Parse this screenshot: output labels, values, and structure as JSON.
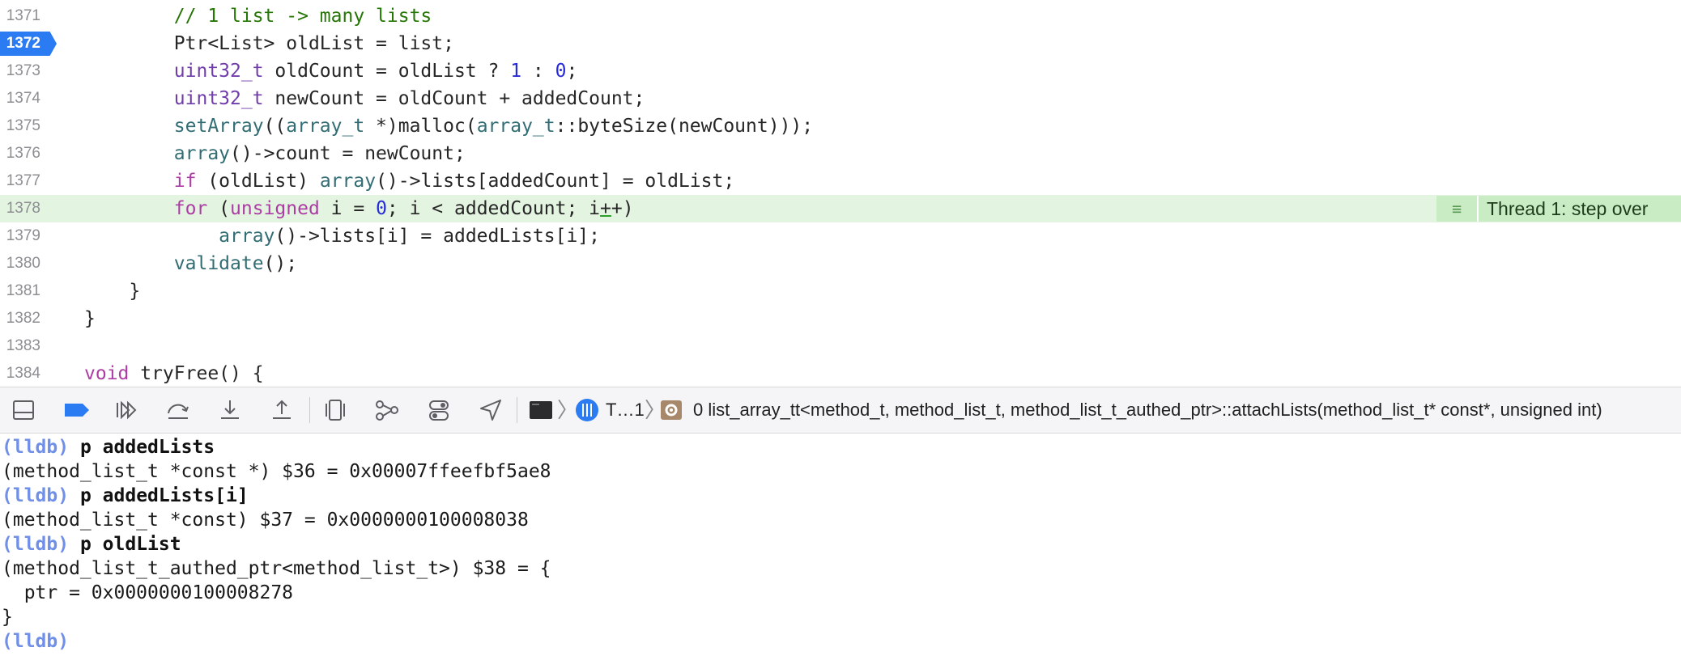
{
  "editor": {
    "lines": [
      {
        "n": "1371",
        "segs": [
          [
            "        ",
            ""
          ],
          [
            "// 1 list -> many lists",
            "cm"
          ]
        ]
      },
      {
        "n": "1372",
        "pc": true,
        "segs": [
          [
            "        ",
            ""
          ],
          [
            "Ptr<List> oldList = list;",
            ""
          ]
        ]
      },
      {
        "n": "1373",
        "segs": [
          [
            "        ",
            ""
          ],
          [
            "uint32_t",
            "ty"
          ],
          [
            " oldCount = oldList ? ",
            ""
          ],
          [
            "1",
            "num"
          ],
          [
            " : ",
            ""
          ],
          [
            "0",
            "num"
          ],
          [
            ";",
            ""
          ]
        ]
      },
      {
        "n": "1374",
        "segs": [
          [
            "        ",
            ""
          ],
          [
            "uint32_t",
            "ty"
          ],
          [
            " newCount = oldCount + addedCount;",
            ""
          ]
        ]
      },
      {
        "n": "1375",
        "segs": [
          [
            "        ",
            ""
          ],
          [
            "setArray",
            "fn"
          ],
          [
            "((",
            ""
          ],
          [
            "array_t",
            "fn"
          ],
          [
            " *)malloc(",
            ""
          ],
          [
            "array_t",
            "fn"
          ],
          [
            "::byteSize(newCount)));",
            ""
          ]
        ]
      },
      {
        "n": "1376",
        "segs": [
          [
            "        ",
            ""
          ],
          [
            "array",
            "fn"
          ],
          [
            "()->count = newCount;",
            ""
          ]
        ]
      },
      {
        "n": "1377",
        "segs": [
          [
            "        ",
            ""
          ],
          [
            "if",
            "kw"
          ],
          [
            " (oldList) ",
            ""
          ],
          [
            "array",
            "fn"
          ],
          [
            "()->lists[addedCount] = oldList;",
            ""
          ]
        ]
      },
      {
        "n": "1378",
        "current": true,
        "segs": [
          [
            "        ",
            ""
          ],
          [
            "for",
            "kw"
          ],
          [
            " (",
            ""
          ],
          [
            "unsigned",
            "kw"
          ],
          [
            " i = ",
            ""
          ],
          [
            "0",
            "num"
          ],
          [
            "; i < addedCount; i",
            ""
          ],
          [
            "+",
            "cursor"
          ],
          [
            "+)",
            ""
          ]
        ]
      },
      {
        "n": "1379",
        "segs": [
          [
            "            ",
            ""
          ],
          [
            "array",
            "fn"
          ],
          [
            "()->lists[i] = addedLists[i];",
            ""
          ]
        ]
      },
      {
        "n": "1380",
        "segs": [
          [
            "        ",
            ""
          ],
          [
            "validate",
            "fn"
          ],
          [
            "();",
            ""
          ]
        ]
      },
      {
        "n": "1381",
        "segs": [
          [
            "    }",
            ""
          ]
        ]
      },
      {
        "n": "1382",
        "segs": [
          [
            "}",
            ""
          ]
        ]
      },
      {
        "n": "1383",
        "segs": []
      },
      {
        "n": "1384",
        "segs": [
          [
            "void",
            "kw"
          ],
          [
            " tryFree() {",
            ""
          ]
        ]
      }
    ],
    "thread_badge": {
      "icon": "list-lines-icon",
      "label": "Thread 1: step over"
    }
  },
  "debug_bar": {
    "buttons": [
      {
        "name": "hide-debug-area-button",
        "icon": "panel-bottom-icon"
      },
      {
        "name": "breakpoints-toggle-button",
        "icon": "breakpoint-icon"
      },
      {
        "name": "continue-button",
        "icon": "continue-icon"
      },
      {
        "name": "step-over-button",
        "icon": "step-over-icon"
      },
      {
        "name": "step-into-button",
        "icon": "step-into-icon"
      },
      {
        "name": "step-out-button",
        "icon": "step-out-icon"
      },
      {
        "name": "debug-view-hierarchy-button",
        "icon": "view-hierarchy-icon"
      },
      {
        "name": "debug-memory-graph-button",
        "icon": "memory-graph-icon"
      },
      {
        "name": "environment-overrides-button",
        "icon": "toggles-icon"
      },
      {
        "name": "simulate-location-button",
        "icon": "location-arrow-icon"
      }
    ],
    "crumbs": {
      "process_icon": "terminal-icon",
      "thread_icon": "thread-icon",
      "thread": "T…1",
      "frame_icon": "gear-icon",
      "frame": "0 list_array_tt<method_t, method_list_t, method_list_t_authed_ptr>::attachLists(method_list_t* const*, unsigned int)"
    }
  },
  "console": {
    "prompt": "(lldb)",
    "lines": [
      {
        "prompt": true,
        "cmd": "p addedLists"
      },
      {
        "text": "(method_list_t *const *) $36 = 0x00007ffeefbf5ae8"
      },
      {
        "prompt": true,
        "cmd": "p addedLists[i]"
      },
      {
        "text": "(method_list_t *const) $37 = 0x0000000100008038"
      },
      {
        "prompt": true,
        "cmd": "p oldList"
      },
      {
        "text": "(method_list_t_authed_ptr<method_list_t>) $38 = {"
      },
      {
        "text": "  ptr = 0x0000000100008278"
      },
      {
        "text": "}"
      },
      {
        "prompt": true,
        "cmd": ""
      }
    ]
  },
  "colors": {
    "keyword": "#ad3da4",
    "type": "#703daa",
    "function": "#326d74",
    "number": "#272ad8",
    "comment": "#267507",
    "current_line": "#e3f5e1",
    "pc_marker": "#2b7cf2",
    "prompt": "#6f8fe8"
  }
}
